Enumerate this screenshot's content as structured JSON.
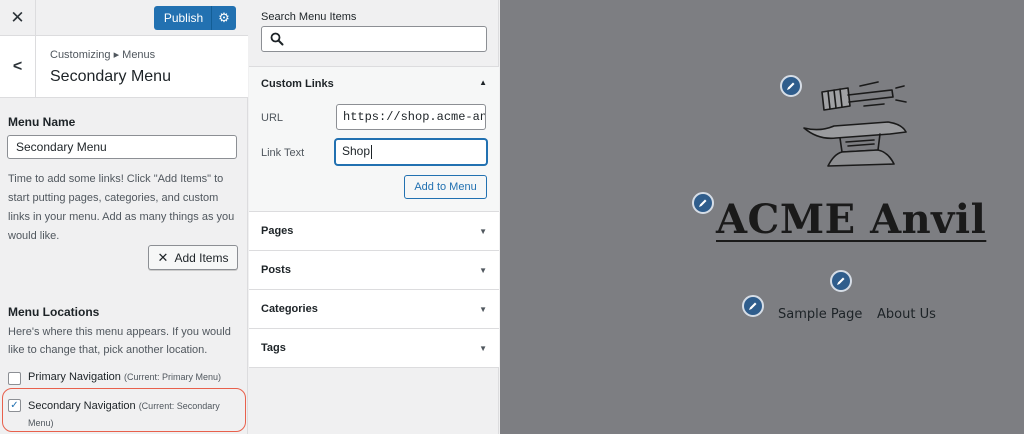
{
  "topbar": {
    "close_label": "✕",
    "publish_label": "Publish"
  },
  "header": {
    "breadcrumb": "Customizing ▸ Menus",
    "title": "Secondary Menu"
  },
  "menu_name": {
    "label": "Menu Name",
    "value": "Secondary Menu"
  },
  "help_text": "Time to add some links! Click \"Add Items\" to start putting pages, categories, and custom links in your menu. Add as many things as you would like.",
  "add_items_label": "Add Items",
  "menu_locations": {
    "label": "Menu Locations",
    "description": "Here's where this menu appears. If you would like to change that, pick another location.",
    "items": [
      {
        "name": "Primary Navigation",
        "current": "(Current: Primary Menu)",
        "checked": false
      },
      {
        "name": "Secondary Navigation",
        "current": "(Current: Secondary Menu)",
        "checked": true
      }
    ]
  },
  "search": {
    "label": "Search Menu Items",
    "value": ""
  },
  "custom_links": {
    "title": "Custom Links",
    "url_label": "URL",
    "url_value": "https://shop.acme-anvil",
    "link_text_label": "Link Text",
    "link_text_value": "Shop",
    "add_button": "Add to Menu"
  },
  "accordion": [
    {
      "label": "Pages"
    },
    {
      "label": "Posts"
    },
    {
      "label": "Categories"
    },
    {
      "label": "Tags"
    }
  ],
  "preview": {
    "site_title": "ACME Anvil",
    "nav": [
      "Sample Page",
      "About Us"
    ]
  },
  "colors": {
    "accent": "#2271b1",
    "preview_bg": "#7d7e82",
    "highlight": "#e8604c"
  }
}
